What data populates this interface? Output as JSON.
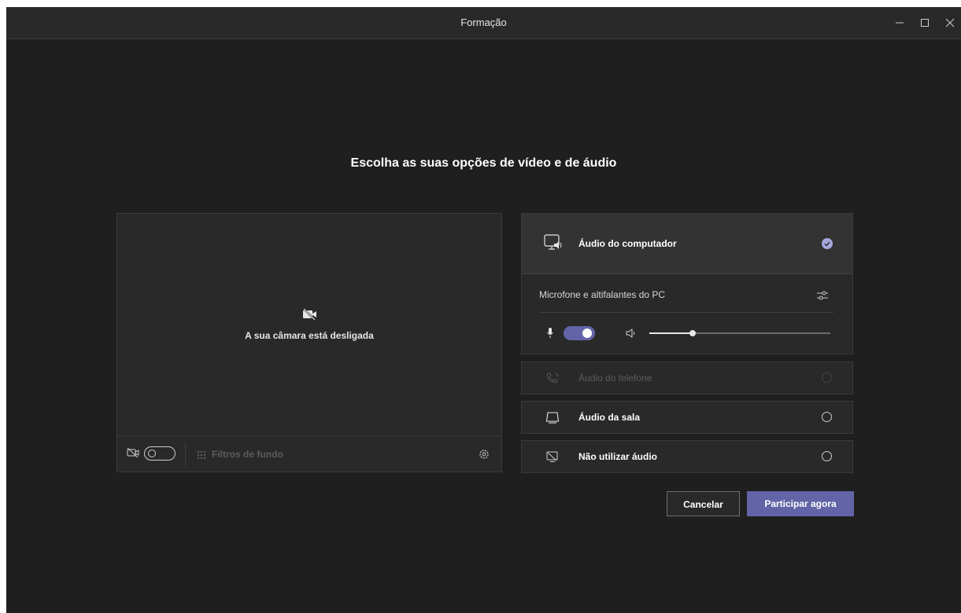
{
  "window": {
    "title": "Formação"
  },
  "heading": "Escolha as suas opções de vídeo e de áudio",
  "video": {
    "camera_off_text": "A sua câmara está desligada",
    "camera_toggle_on": false,
    "background_filters_label": "Filtros de fundo"
  },
  "audio": {
    "computer_audio_label": "Áudio do computador",
    "computer_audio_selected": true,
    "device_label": "Microfone e altifalantes do PC",
    "mic_on": true,
    "speaker_volume": 0.24,
    "options": [
      {
        "label": "Áudio do telefone",
        "disabled": true,
        "selected": false
      },
      {
        "label": "Áudio da sala",
        "disabled": false,
        "selected": false
      },
      {
        "label": "Não utilizar áudio",
        "disabled": false,
        "selected": false
      }
    ]
  },
  "buttons": {
    "cancel": "Cancelar",
    "join": "Participar agora"
  },
  "colors": {
    "accent": "#6264a7",
    "background": "#1f1f1f",
    "panel": "#292929"
  }
}
